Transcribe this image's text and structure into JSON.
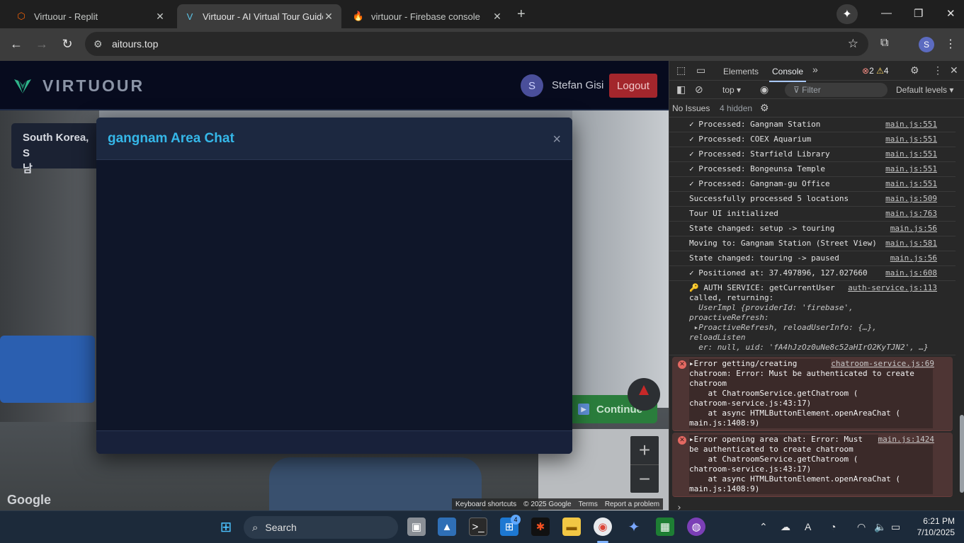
{
  "browser": {
    "tabs": [
      {
        "title": "Virtuour - Replit",
        "favicon": "replit-icon",
        "active": false
      },
      {
        "title": "Virtuour - AI Virtual Tour Guide",
        "favicon": "virtuour-icon",
        "active": true
      },
      {
        "title": "virtuour - Firebase console",
        "favicon": "firebase-icon",
        "active": false
      }
    ],
    "url": "aitours.top",
    "profile_initial": "S"
  },
  "app": {
    "brand": "VIRTUOUR",
    "user_initial": "S",
    "user_name": "Stefan Gisi",
    "logout_label": "Logout",
    "location_label": "South Korea, S\n남",
    "continue_label": "Continue",
    "zoom_in": "+",
    "zoom_out": "−",
    "map_logo": "Google",
    "attribution": [
      "Keyboard shortcuts",
      "© 2025 Google",
      "Terms",
      "Report a problem"
    ],
    "modal": {
      "title": "gangnam Area Chat",
      "close": "×"
    }
  },
  "devtools": {
    "tabs": [
      "Elements",
      "Console"
    ],
    "error_count": "2",
    "warning_count": "4",
    "context": "top",
    "filter_placeholder": "Filter",
    "levels": "Default levels",
    "issues": "No Issues",
    "hidden": "4 hidden",
    "logs": [
      {
        "text": "✓ Processed: Gangnam Station",
        "src": "main.js:551"
      },
      {
        "text": "✓ Processed: COEX Aquarium",
        "src": "main.js:551"
      },
      {
        "text": "✓ Processed: Starfield Library",
        "src": "main.js:551"
      },
      {
        "text": "✓ Processed: Bongeunsa Temple",
        "src": "main.js:551"
      },
      {
        "text": "✓ Processed: Gangnam-gu Office",
        "src": "main.js:551"
      },
      {
        "text": "Successfully processed 5 locations",
        "src": "main.js:509"
      },
      {
        "text": "Tour UI initialized",
        "src": "main.js:763"
      },
      {
        "text": "State changed: setup -> touring",
        "src": "main.js:56"
      },
      {
        "text": "Moving to: Gangnam Station (Street View)",
        "src": "main.js:581"
      },
      {
        "text": "State changed: touring -> paused",
        "src": "main.js:56"
      },
      {
        "text": "✓ Positioned at: 37.497896, 127.027660",
        "src": "main.js:608"
      }
    ],
    "auth_log": {
      "text": "🔑 AUTH SERVICE: getCurrentUser\ncalled, returning:",
      "src": "auth-service.js:113",
      "object_line1": "  UserImpl {providerId: 'firebase', proactiveRefresh:",
      "object_line2": " ▸ProactiveRefresh, reloadUserInfo: {…}, reloadListen\n  er: null, uid: 'fA4hJzOz0uNe8c52aHIrO2KyTJN2', …}"
    },
    "errors": [
      {
        "text": "▸Error getting/creating\nchatroom: Error: Must be authenticated to create\nchatroom\n    at ChatroomService.getChatroom (\nchatroom-service.js:43:17)\n    at async HTMLButtonElement.openAreaChat (\nmain.js:1408:9)",
        "src": "chatroom-service.js:69"
      },
      {
        "text": "▸Error opening area chat: Error: Must\nbe authenticated to create chatroom\n    at ChatroomService.getChatroom (\nchatroom-service.js:43:17)\n    at async HTMLButtonElement.openAreaChat (\nmain.js:1408:9)",
        "src": "main.js:1424"
      }
    ],
    "prompt": "›"
  },
  "taskbar": {
    "search_placeholder": "Search",
    "store_badge": "4",
    "time": "6:21 PM",
    "date": "7/10/2025"
  }
}
